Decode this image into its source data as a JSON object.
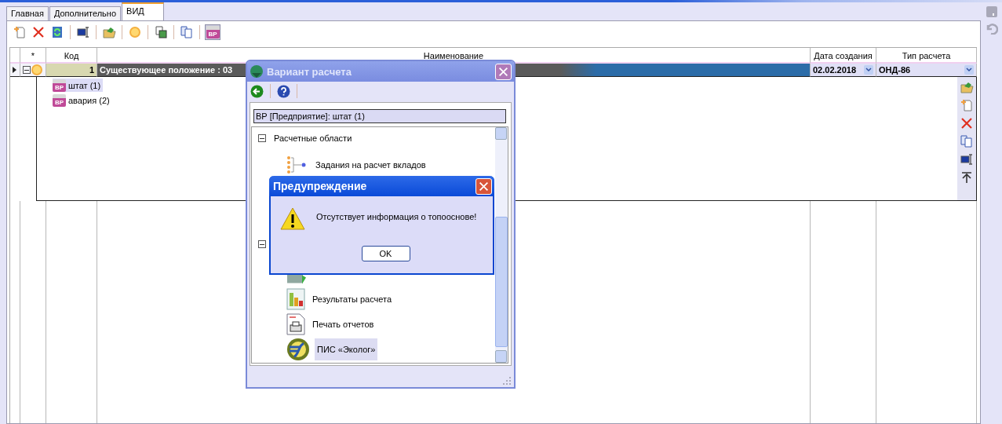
{
  "tabs": [
    {
      "label": "Главная",
      "selected": false
    },
    {
      "label": "Дополнительно",
      "selected": false
    },
    {
      "label": "ВИД",
      "selected": true
    }
  ],
  "toolbar_toggle": {
    "badge": "ВР",
    "on": true
  },
  "grid": {
    "columns": [
      "*",
      "Код",
      "Наименование",
      "Дата создания",
      "Тип расчета"
    ],
    "rows": [
      {
        "code": "1",
        "name": "Существующее положение : 03",
        "date": "02.02.2018",
        "type": "ОНД-86",
        "selected": true,
        "expanded": true,
        "children": [
          {
            "label": "штат (1)",
            "badge": "ВР",
            "selected": true
          },
          {
            "label": "авария (2)",
            "badge": "ВР",
            "selected": false
          }
        ]
      }
    ]
  },
  "dialog": {
    "title": "Вариант расчета",
    "header": "ВР [Предприятие]: штат (1)",
    "sections": [
      {
        "title": "Расчетные области",
        "expanded": true,
        "items": [
          {
            "kind": "tasks",
            "label": "Задания на расчет вкладов",
            "selected": false
          }
        ]
      },
      {
        "expanded": true,
        "items": [
          {
            "kind": "table",
            "selected": false
          },
          {
            "kind": "results",
            "label": "Результаты расчета",
            "selected": false
          },
          {
            "kind": "print",
            "label": "Печать отчетов",
            "selected": false
          },
          {
            "kind": "ecolog",
            "label": "ПИС «Эколог»",
            "selected": true
          }
        ]
      }
    ]
  },
  "warning": {
    "title": "Предупреждение",
    "message": "Отсутствует информация о топооснове!",
    "button": "OK"
  }
}
